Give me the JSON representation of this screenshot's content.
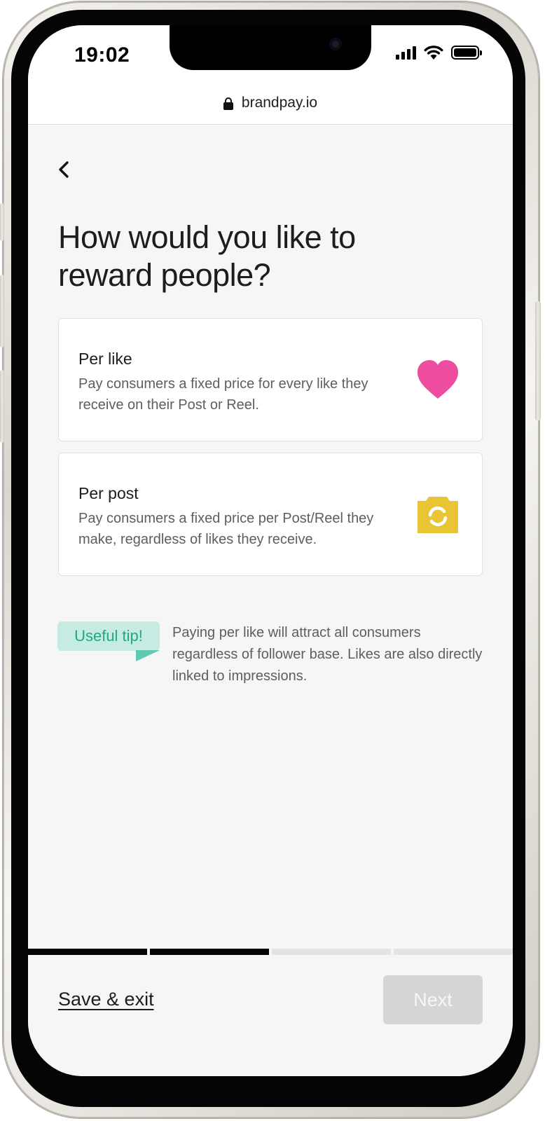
{
  "status_bar": {
    "time": "19:02",
    "icons": [
      "signal-icon",
      "wifi-icon",
      "battery-icon"
    ]
  },
  "browser": {
    "url": "brandpay.io",
    "icon": "lock-icon"
  },
  "page": {
    "back_icon": "chevron-left-icon",
    "title": "How would you like to reward people?"
  },
  "options": [
    {
      "title": "Per like",
      "description": "Pay consumers a fixed price for every like they receive on their Post or Reel.",
      "icon": "heart-icon",
      "icon_color": "#ee4c9f"
    },
    {
      "title": "Per post",
      "description": "Pay consumers a fixed price per Post/Reel they make, regardless of likes they receive.",
      "icon": "camera-icon",
      "icon_color": "#e9c536"
    }
  ],
  "tip": {
    "label": "Useful tip!",
    "text": "Paying per like will attract all consumers regardless of follower base. Likes are also directly linked to impressions.",
    "badge_color": "#c5ebe2",
    "label_color": "#1fa888"
  },
  "progress": {
    "steps_total": 4,
    "steps_completed": 2
  },
  "footer": {
    "save_exit_label": "Save & exit",
    "next_label": "Next",
    "next_enabled": false
  }
}
